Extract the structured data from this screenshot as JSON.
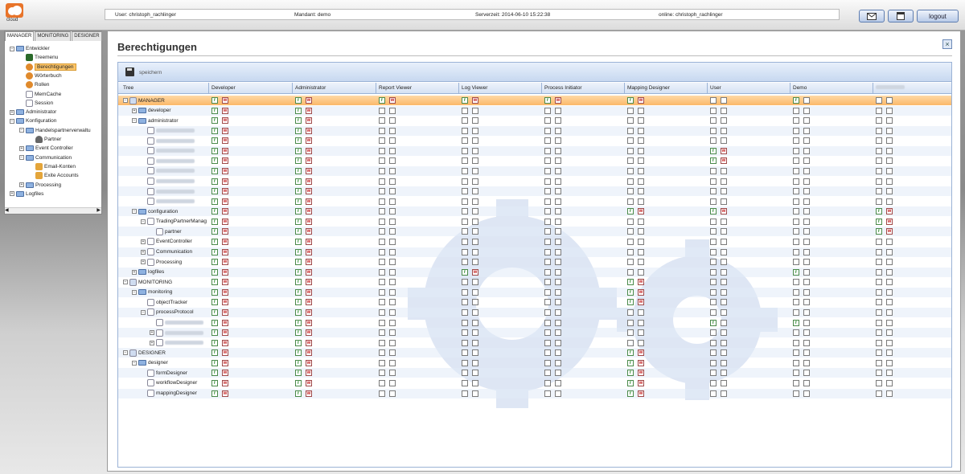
{
  "header": {
    "logo_text": "cloud",
    "user": "User: christoph_rachlinger",
    "mandant": "Mandant: demo",
    "serverzeit": "Serverzeit: 2014-06-10 15:22:38",
    "online": "online: christoph_rachlinger",
    "logout_label": "logout",
    "mail_icon": "mail-icon",
    "calendar_icon": "calendar-icon"
  },
  "left_panel": {
    "tabs": [
      "MANAGER",
      "MONITORING",
      "DESIGNER"
    ],
    "active_tab": "MANAGER",
    "tree": [
      {
        "label": "Entwickler",
        "level": 0,
        "expander": "−",
        "icon": "folder"
      },
      {
        "label": "Treemenu",
        "level": 1,
        "expander": "",
        "icon": "tree"
      },
      {
        "label": "Berechtigungen",
        "level": 1,
        "expander": "",
        "icon": "gear",
        "selected": true
      },
      {
        "label": "Wörterbuch",
        "level": 1,
        "expander": "",
        "icon": "gear"
      },
      {
        "label": "Rollen",
        "level": 1,
        "expander": "",
        "icon": "gear"
      },
      {
        "label": "MemCache",
        "level": 1,
        "expander": "",
        "icon": "page"
      },
      {
        "label": "Session",
        "level": 1,
        "expander": "",
        "icon": "page"
      },
      {
        "label": "Administrator",
        "level": 0,
        "expander": "+",
        "icon": "folder"
      },
      {
        "label": "Konfiguration",
        "level": 0,
        "expander": "−",
        "icon": "folder"
      },
      {
        "label": "Handelspartnerverwaltu",
        "level": 1,
        "expander": "−",
        "icon": "folder"
      },
      {
        "label": "Partner",
        "level": 2,
        "expander": "",
        "icon": "user"
      },
      {
        "label": "Event Controller",
        "level": 1,
        "expander": "+",
        "icon": "folder"
      },
      {
        "label": "Communication",
        "level": 1,
        "expander": "−",
        "icon": "folder"
      },
      {
        "label": "Email-Konten",
        "level": 2,
        "expander": "",
        "icon": "mail"
      },
      {
        "label": "Exite Accounts",
        "level": 2,
        "expander": "",
        "icon": "mail"
      },
      {
        "label": "Processing",
        "level": 1,
        "expander": "+",
        "icon": "folder"
      },
      {
        "label": "Logfiles",
        "level": 0,
        "expander": "+",
        "icon": "folder"
      }
    ]
  },
  "main": {
    "title": "Berechtigungen",
    "close_icon": "close-icon",
    "save_label": "speichern",
    "columns": [
      "Tree",
      "Developer",
      "Administrator",
      "Report Viewer",
      "Log Viewer",
      "Process Initiator",
      "Mapping Designer",
      "User",
      "Demo",
      ""
    ],
    "rows": [
      {
        "label": "MANAGER",
        "level": 0,
        "expander": "−",
        "icon": "root",
        "perms": [
          "rw",
          "rw",
          "rw",
          "rw",
          "rw",
          "rw",
          "--",
          "r-",
          "--"
        ],
        "highlight": true
      },
      {
        "label": "developer",
        "level": 1,
        "expander": "+",
        "icon": "folder",
        "perms": [
          "rw",
          "rw",
          "--",
          "--",
          "--",
          "--",
          "--",
          "--",
          "--"
        ]
      },
      {
        "label": "administrator",
        "level": 1,
        "expander": "−",
        "icon": "folder",
        "perms": [
          "rw",
          "rw",
          "--",
          "--",
          "--",
          "--",
          "--",
          "--",
          "--"
        ]
      },
      {
        "label": "",
        "level": 2,
        "expander": "",
        "icon": "page",
        "blurred": true,
        "perms": [
          "rw",
          "rw",
          "--",
          "--",
          "--",
          "--",
          "--",
          "--",
          "--"
        ]
      },
      {
        "label": "",
        "level": 2,
        "expander": "",
        "icon": "page",
        "blurred": true,
        "perms": [
          "rw",
          "rw",
          "--",
          "--",
          "--",
          "--",
          "--",
          "--",
          "--"
        ]
      },
      {
        "label": "",
        "level": 2,
        "expander": "",
        "icon": "page",
        "blurred": true,
        "perms": [
          "rw",
          "rw",
          "--",
          "--",
          "--",
          "--",
          "rw",
          "--",
          "--"
        ]
      },
      {
        "label": "",
        "level": 2,
        "expander": "",
        "icon": "page",
        "blurred": true,
        "perms": [
          "rw",
          "rw",
          "--",
          "--",
          "--",
          "--",
          "rw",
          "--",
          "--"
        ]
      },
      {
        "label": "",
        "level": 2,
        "expander": "",
        "icon": "page",
        "blurred": true,
        "perms": [
          "rw",
          "rw",
          "--",
          "--",
          "--",
          "--",
          "--",
          "--",
          "--"
        ]
      },
      {
        "label": "",
        "level": 2,
        "expander": "",
        "icon": "page",
        "blurred": true,
        "perms": [
          "rw",
          "rw",
          "--",
          "--",
          "--",
          "--",
          "--",
          "--",
          "--"
        ]
      },
      {
        "label": "",
        "level": 2,
        "expander": "",
        "icon": "page",
        "blurred": true,
        "perms": [
          "rw",
          "rw",
          "--",
          "--",
          "--",
          "--",
          "--",
          "--",
          "--"
        ]
      },
      {
        "label": "",
        "level": 2,
        "expander": "",
        "icon": "page",
        "blurred": true,
        "perms": [
          "rw",
          "rw",
          "--",
          "--",
          "--",
          "--",
          "--",
          "--",
          "--"
        ]
      },
      {
        "label": "configuration",
        "level": 1,
        "expander": "−",
        "icon": "folder",
        "perms": [
          "rw",
          "rw",
          "--",
          "--",
          "--",
          "rw",
          "rw",
          "--",
          "rw"
        ]
      },
      {
        "label": "TradingPartnerManag",
        "level": 2,
        "expander": "−",
        "icon": "page",
        "perms": [
          "rw",
          "rw",
          "--",
          "--",
          "--",
          "--",
          "--",
          "--",
          "rw"
        ]
      },
      {
        "label": "partner",
        "level": 3,
        "expander": "",
        "icon": "page",
        "perms": [
          "rw",
          "rw",
          "--",
          "--",
          "--",
          "--",
          "--",
          "--",
          "rw"
        ]
      },
      {
        "label": "EventController",
        "level": 2,
        "expander": "+",
        "icon": "page",
        "perms": [
          "rw",
          "rw",
          "--",
          "--",
          "--",
          "--",
          "--",
          "--",
          "--"
        ]
      },
      {
        "label": "Communication",
        "level": 2,
        "expander": "+",
        "icon": "page",
        "perms": [
          "rw",
          "rw",
          "--",
          "--",
          "--",
          "--",
          "--",
          "--",
          "--"
        ]
      },
      {
        "label": "Processing",
        "level": 2,
        "expander": "+",
        "icon": "page",
        "perms": [
          "rw",
          "rw",
          "--",
          "--",
          "--",
          "--",
          "--",
          "--",
          "--"
        ]
      },
      {
        "label": "logfiles",
        "level": 1,
        "expander": "+",
        "icon": "folder",
        "perms": [
          "rw",
          "rw",
          "--",
          "rw",
          "--",
          "--",
          "--",
          "r-",
          "--"
        ]
      },
      {
        "label": "MONITORING",
        "level": 0,
        "expander": "−",
        "icon": "root",
        "perms": [
          "rw",
          "rw",
          "--",
          "--",
          "--",
          "rw",
          "--",
          "--",
          "--"
        ]
      },
      {
        "label": "monitoring",
        "level": 1,
        "expander": "−",
        "icon": "folder",
        "perms": [
          "rw",
          "rw",
          "--",
          "--",
          "--",
          "rw",
          "--",
          "--",
          "--"
        ]
      },
      {
        "label": "objectTracker",
        "level": 2,
        "expander": "",
        "icon": "page",
        "perms": [
          "rw",
          "rw",
          "--",
          "--",
          "--",
          "rw",
          "--",
          "--",
          "--"
        ]
      },
      {
        "label": "processProtocol",
        "level": 2,
        "expander": "−",
        "icon": "page",
        "perms": [
          "rw",
          "rw",
          "--",
          "--",
          "--",
          "--",
          "--",
          "--",
          "--"
        ]
      },
      {
        "label": "",
        "level": 3,
        "expander": "",
        "icon": "page",
        "blurred": true,
        "perms": [
          "rw",
          "rw",
          "--",
          "--",
          "--",
          "--",
          "r-",
          "r-",
          "--"
        ]
      },
      {
        "label": "",
        "level": 3,
        "expander": "+",
        "icon": "page",
        "blurred": true,
        "perms": [
          "rw",
          "rw",
          "--",
          "--",
          "--",
          "--",
          "--",
          "--",
          "--"
        ]
      },
      {
        "label": "",
        "level": 3,
        "expander": "+",
        "icon": "page",
        "blurred": true,
        "perms": [
          "rw",
          "rw",
          "--",
          "--",
          "--",
          "--",
          "--",
          "--",
          "--"
        ]
      },
      {
        "label": "DESIGNER",
        "level": 0,
        "expander": "−",
        "icon": "root",
        "perms": [
          "rw",
          "rw",
          "--",
          "--",
          "--",
          "rw",
          "--",
          "--",
          "--"
        ]
      },
      {
        "label": "designer",
        "level": 1,
        "expander": "−",
        "icon": "folder",
        "perms": [
          "rw",
          "rw",
          "--",
          "--",
          "--",
          "rw",
          "--",
          "--",
          "--"
        ]
      },
      {
        "label": "formDesigner",
        "level": 2,
        "expander": "",
        "icon": "page",
        "perms": [
          "rw",
          "rw",
          "--",
          "--",
          "--",
          "rw",
          "--",
          "--",
          "--"
        ]
      },
      {
        "label": "workflowDesigner",
        "level": 2,
        "expander": "",
        "icon": "page",
        "perms": [
          "rw",
          "rw",
          "--",
          "--",
          "--",
          "rw",
          "--",
          "--",
          "--"
        ]
      },
      {
        "label": "mappingDesigner",
        "level": 2,
        "expander": "",
        "icon": "page",
        "perms": [
          "rw",
          "rw",
          "--",
          "--",
          "--",
          "rw",
          "--",
          "--",
          "--"
        ]
      }
    ]
  },
  "colors": {
    "highlight_row": "#fbb86a",
    "selected_tree": "#fbc56a",
    "header_blue": "#d5e2f4",
    "read": "#2a8a2a",
    "write": "#c32020"
  }
}
